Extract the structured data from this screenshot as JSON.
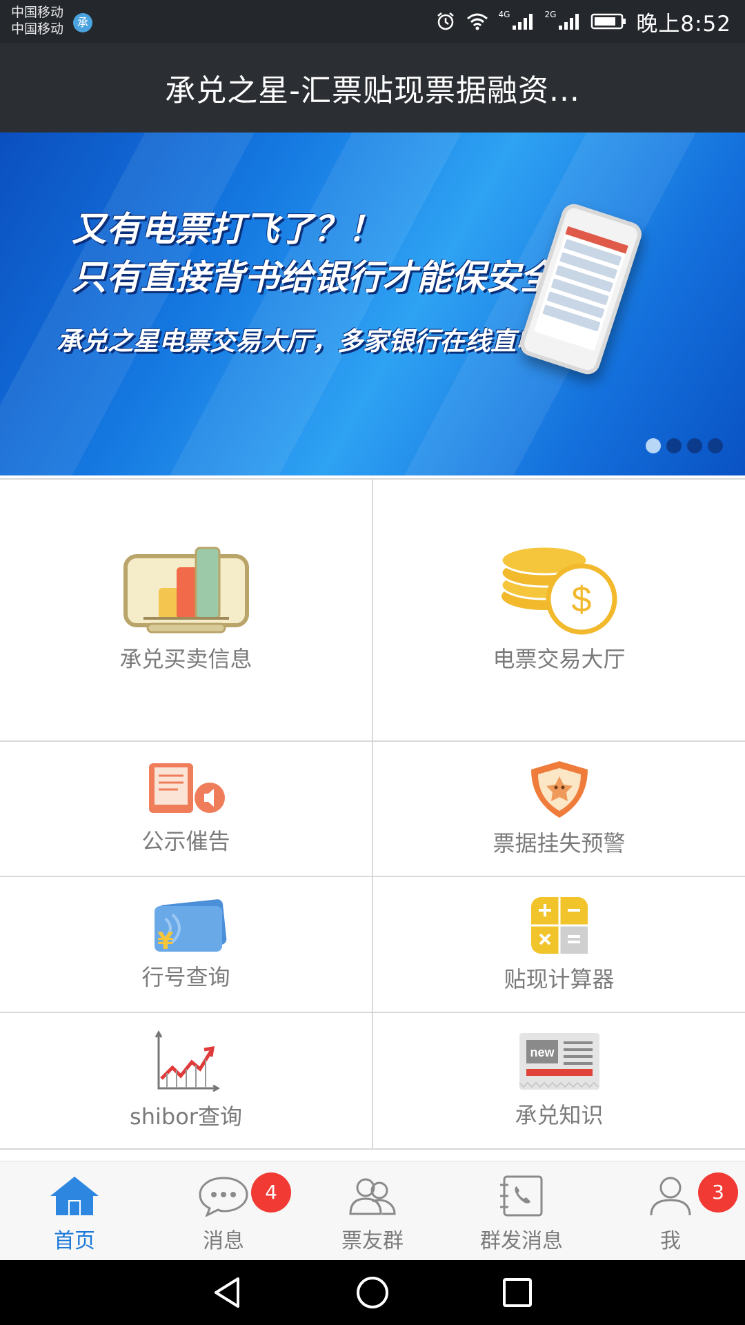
{
  "status_bar": {
    "carrier_1": "中国移动",
    "carrier_2": "中国移动",
    "app_badge": "承",
    "net_1": "4G",
    "net_2": "2G",
    "time": "晚上8:52",
    "icons": [
      "alarm-icon",
      "wifi-icon",
      "signal-icon",
      "signal-icon",
      "battery-icon"
    ]
  },
  "header": {
    "title": "承兑之星-汇票贴现票据融资..."
  },
  "banner": {
    "line_1": "又有电票打飞了？！",
    "line_2": "只有直接背书给银行才能保安全！",
    "line_3": "承兑之星电票交易大厅，多家银行在线直收电票！",
    "page_count": 4,
    "active_page": 1
  },
  "grid": {
    "items": [
      {
        "label": "承兑买卖信息",
        "icon": "chart-board-icon"
      },
      {
        "label": "电票交易大厅",
        "icon": "coins-dollar-icon"
      },
      {
        "label": "公示催告",
        "icon": "notice-speaker-icon"
      },
      {
        "label": "票据挂失预警",
        "icon": "shield-alert-icon"
      },
      {
        "label": "行号查询",
        "icon": "card-yuan-icon"
      },
      {
        "label": "贴现计算器",
        "icon": "calculator-icon"
      },
      {
        "label": "shibor查询",
        "icon": "trend-chart-icon"
      },
      {
        "label": "承兑知识",
        "icon": "newspaper-icon"
      }
    ],
    "newspaper_tag": "new"
  },
  "tab_bar": {
    "tabs": [
      {
        "label": "首页",
        "icon": "home-icon",
        "active": true
      },
      {
        "label": "消息",
        "icon": "chat-bubble-icon",
        "badge": "4"
      },
      {
        "label": "票友群",
        "icon": "group-icon"
      },
      {
        "label": "群发消息",
        "icon": "contact-book-icon"
      },
      {
        "label": "我",
        "icon": "person-icon",
        "badge": "3"
      }
    ],
    "colors": {
      "active": "#1a78d8",
      "inactive": "#7b7b7b",
      "badge": "#f03a33"
    }
  },
  "nav_bar": {
    "buttons": [
      "back-icon",
      "home-circle-icon",
      "recents-icon"
    ]
  }
}
